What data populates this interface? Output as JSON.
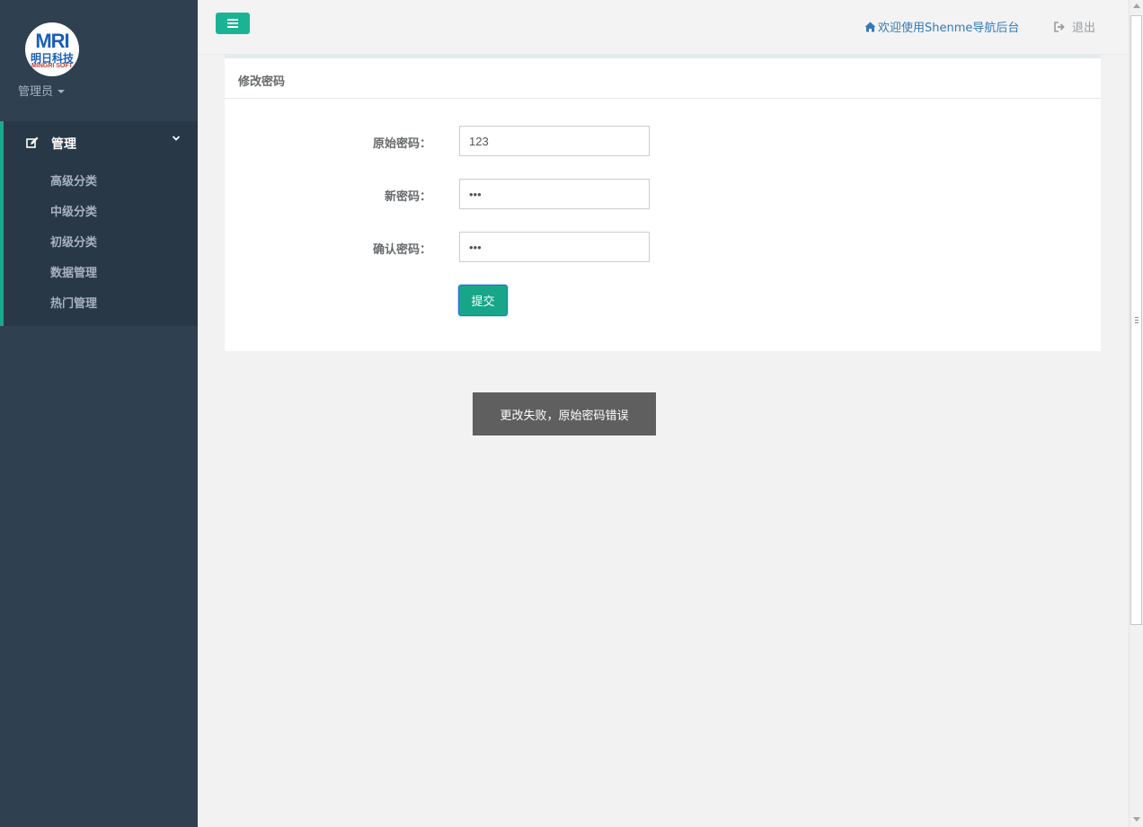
{
  "sidebar": {
    "logo": {
      "big_text": "MRI",
      "cn_text": "明日科技",
      "en_text": "MINGRI SOFT"
    },
    "admin_label": "管理员",
    "menu": {
      "title": "管理",
      "items": [
        {
          "label": "高级分类"
        },
        {
          "label": "中级分类"
        },
        {
          "label": "初级分类"
        },
        {
          "label": "数据管理"
        },
        {
          "label": "热门管理"
        }
      ]
    }
  },
  "topbar": {
    "welcome": "欢迎使用Shenme导航后台",
    "logout": "退出"
  },
  "form": {
    "title": "修改密码",
    "fields": [
      {
        "label": "原始密码：",
        "value": "123"
      },
      {
        "label": "新密码：",
        "value": "•••"
      },
      {
        "label": "确认密码：",
        "value": "•••"
      }
    ],
    "submit": "提交"
  },
  "toast": "更改失败，原始密码错误",
  "colors": {
    "sidebar_bg": "#2f4050",
    "menu_bg": "#293846",
    "accent": "#1ab394",
    "link": "#337ab7"
  }
}
